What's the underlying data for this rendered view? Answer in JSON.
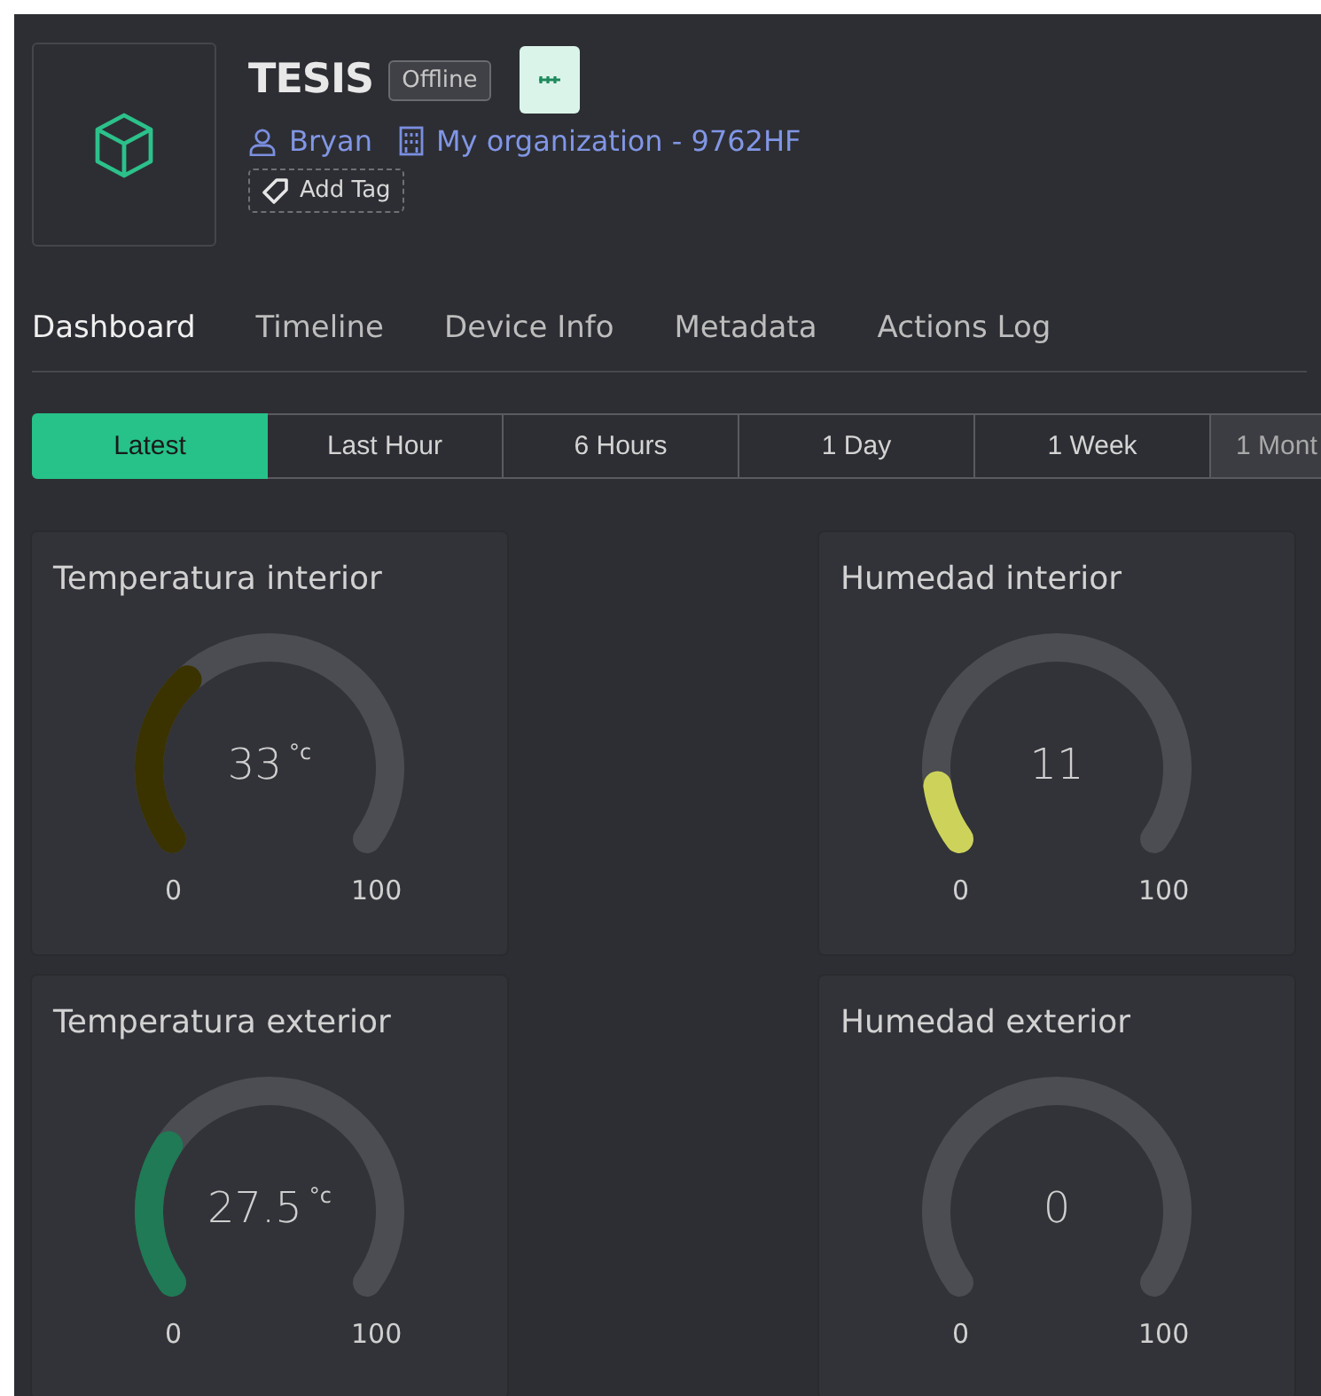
{
  "device": {
    "name": "TESIS",
    "status": "Offline",
    "owner": "Bryan",
    "organization": "My organization - 9762HF",
    "add_tag": "Add Tag"
  },
  "tabs": [
    {
      "label": "Dashboard",
      "selected": true
    },
    {
      "label": "Timeline",
      "selected": false
    },
    {
      "label": "Device Info",
      "selected": false
    },
    {
      "label": "Metadata",
      "selected": false
    },
    {
      "label": "Actions Log",
      "selected": false
    }
  ],
  "ranges": [
    {
      "label": "Latest",
      "selected": true
    },
    {
      "label": "Last Hour",
      "selected": false
    },
    {
      "label": "6 Hours",
      "selected": false
    },
    {
      "label": "1 Day",
      "selected": false
    },
    {
      "label": "1 Week",
      "selected": false
    },
    {
      "label": "1 Mont",
      "selected": false
    }
  ],
  "gauges": [
    {
      "title": "Temperatura interior",
      "value": "33",
      "unit": "°c",
      "color": "#3a3300",
      "min": "0",
      "max": "100"
    },
    {
      "title": "Humedad interior",
      "value": "11",
      "color": "#cdd35a",
      "min": "0",
      "max": "100"
    },
    {
      "title": "Temperatura exterior",
      "value": "27.5",
      "unit": "°c",
      "color": "#1f7a55",
      "min": "0",
      "max": "100"
    },
    {
      "title": "Humedad exterior",
      "value": "0",
      "min": "0",
      "max": "100"
    }
  ]
}
